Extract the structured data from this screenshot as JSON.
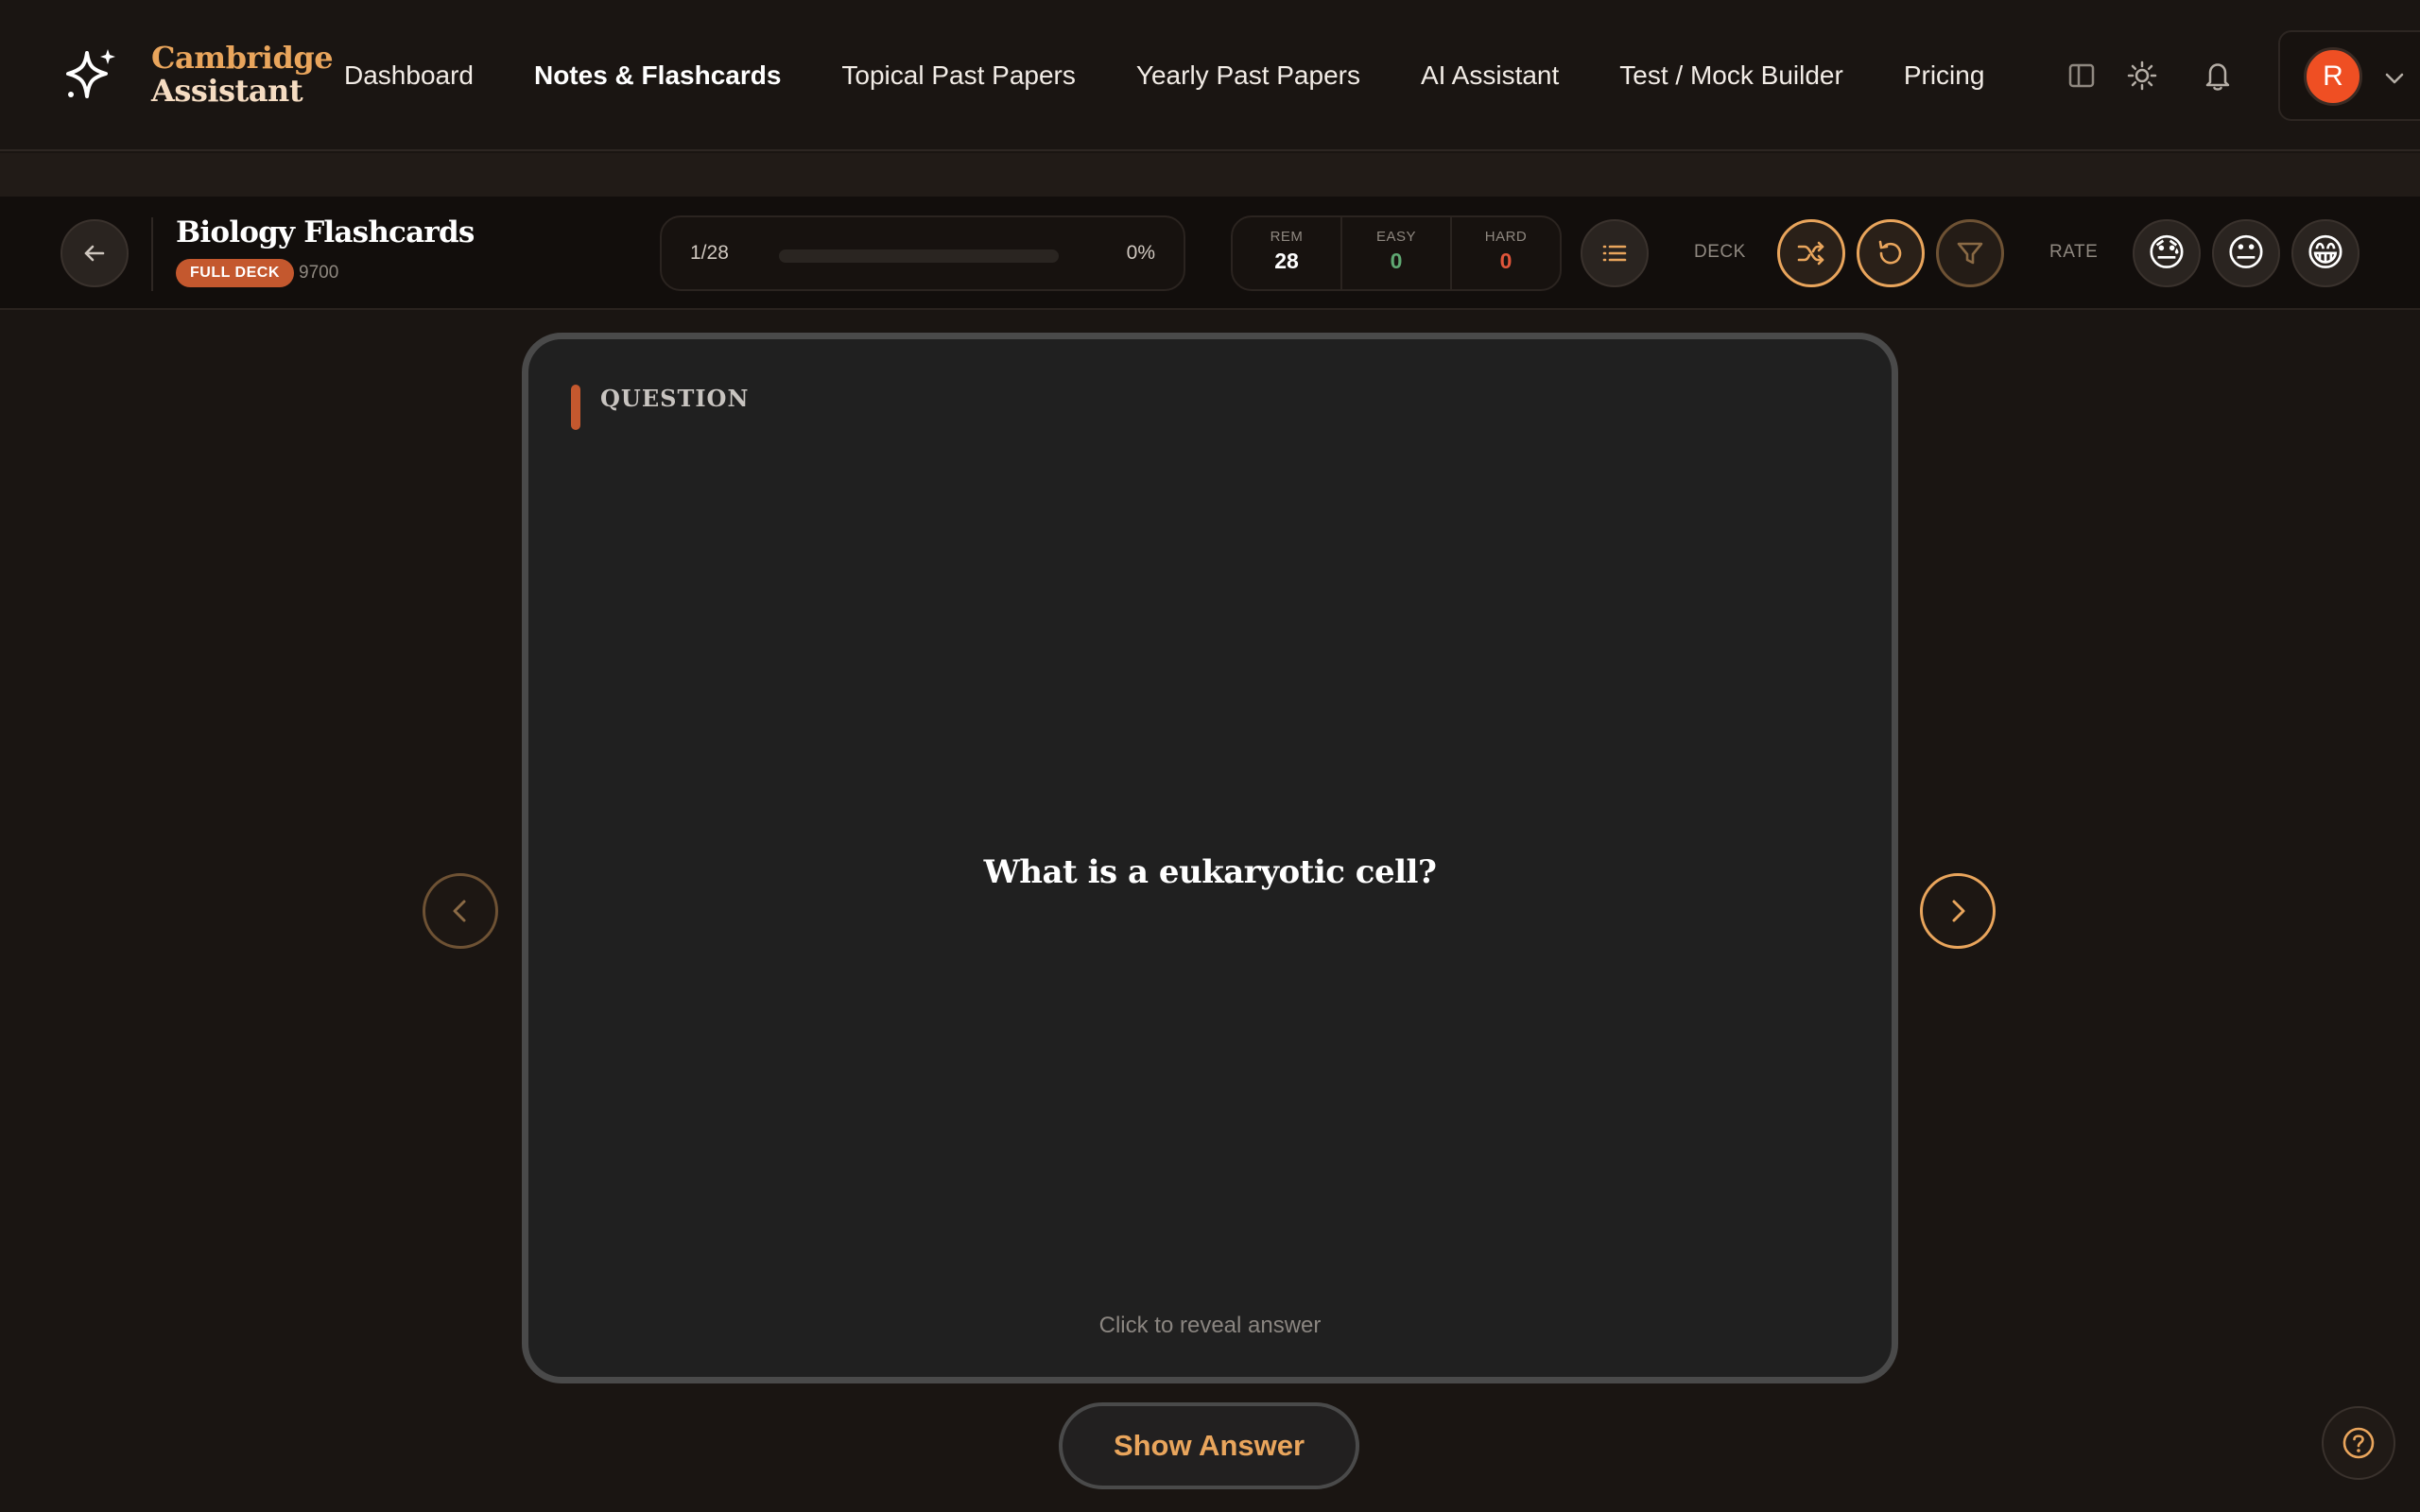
{
  "brand": {
    "line1": "Cambridge",
    "line2": "Assistant"
  },
  "nav": {
    "items": [
      {
        "label": "Dashboard"
      },
      {
        "label": "Notes & Flashcards"
      },
      {
        "label": "Topical Past Papers"
      },
      {
        "label": "Yearly Past Papers"
      },
      {
        "label": "AI Assistant"
      },
      {
        "label": "Test / Mock Builder"
      },
      {
        "label": "Pricing"
      }
    ],
    "active": "Notes & Flashcards"
  },
  "account": {
    "avatar_initial": "R"
  },
  "deck": {
    "title": "Biology Flashcards",
    "badge": "FULL DECK",
    "code": "9700"
  },
  "progress": {
    "count": "1/28",
    "percent_label": "0%",
    "fraction": 0
  },
  "stats": {
    "rem_label": "REM",
    "rem_value": "28",
    "easy_label": "EASY",
    "easy_value": "0",
    "hard_label": "HARD",
    "hard_value": "0"
  },
  "toolbar": {
    "deck_label": "DECK",
    "rate_label": "RATE"
  },
  "rate": {
    "hard_emoji": "😓",
    "ok_emoji": "😐",
    "easy_emoji": "😁"
  },
  "card": {
    "side_label": "QUESTION",
    "question": "What is a eukaryotic cell?",
    "hint": "Click to reveal answer"
  },
  "actions": {
    "show_answer": "Show Answer"
  },
  "colors": {
    "accent": "#e9a55c",
    "brand_orange": "#c4582e",
    "avatar": "#ef4f23",
    "easy": "#5fa872",
    "hard": "#e0553a",
    "background": "#1a1512"
  }
}
